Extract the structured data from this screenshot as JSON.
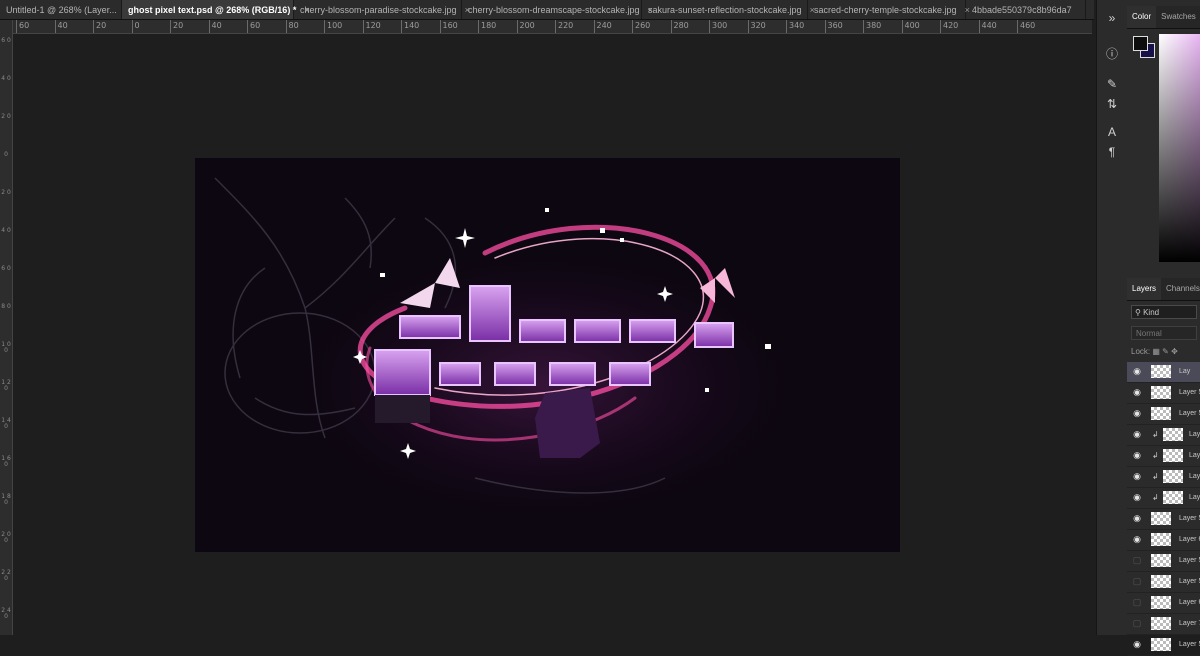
{
  "tabs": [
    {
      "label": "Untitled-1 @ 268% (Layer...",
      "active": false
    },
    {
      "label": "ghost pixel text.psd @ 268% (RGB/16) *",
      "active": true
    },
    {
      "label": "cherry-blossom-paradise-stockcake.jpg",
      "active": false
    },
    {
      "label": "cherry-blossom-dreamscape-stockcake.jpg",
      "active": false
    },
    {
      "label": "sakura-sunset-reflection-stockcake.jpg",
      "active": false
    },
    {
      "label": "sacred-cherry-temple-stockcake.jpg",
      "active": false
    },
    {
      "label": "4bbade550379c8b96da7",
      "active": false
    }
  ],
  "tab_close": "×",
  "overflow": "»",
  "ruler_top": [
    "60",
    "40",
    "20",
    "0",
    "20",
    "40",
    "60",
    "80",
    "100",
    "120",
    "140",
    "160",
    "180",
    "200",
    "220",
    "240",
    "260",
    "280",
    "300",
    "320",
    "340",
    "360",
    "380",
    "400",
    "420",
    "440",
    "460"
  ],
  "ruler_left": [
    "6 0",
    "4 0",
    "2 0",
    "0",
    "2 0",
    "4 0",
    "6 0",
    "8 0",
    "1 0 0",
    "1 2 0",
    "1 4 0",
    "1 6 0",
    "1 8 0",
    "2 0 0",
    "2 2 0",
    "2 4 0"
  ],
  "color_panel": {
    "tabs": [
      "Color",
      "Swatches"
    ],
    "fg": "#0d0d0d",
    "bg": "#17114a"
  },
  "layers_panel": {
    "tabs": [
      "Layers",
      "Channels"
    ],
    "kind_label": "Kind",
    "blend_mode": "Normal",
    "locks_label": "Lock:",
    "rows": [
      {
        "name": "Lay",
        "visible": true,
        "clipped": false,
        "selected": true
      },
      {
        "name": "Layer 5",
        "visible": true,
        "clipped": false,
        "selected": false
      },
      {
        "name": "Layer 5",
        "visible": true,
        "clipped": false,
        "selected": false
      },
      {
        "name": "Lay",
        "visible": true,
        "clipped": true,
        "selected": false
      },
      {
        "name": "Lay",
        "visible": true,
        "clipped": true,
        "selected": false
      },
      {
        "name": "Lay",
        "visible": true,
        "clipped": true,
        "selected": false
      },
      {
        "name": "Lay",
        "visible": true,
        "clipped": true,
        "selected": false
      },
      {
        "name": "Layer 5",
        "visible": true,
        "clipped": false,
        "selected": false
      },
      {
        "name": "Layer 6",
        "visible": true,
        "clipped": false,
        "selected": false
      },
      {
        "name": "Layer 5",
        "visible": false,
        "clipped": false,
        "selected": false
      },
      {
        "name": "Layer 5",
        "visible": false,
        "clipped": false,
        "selected": false
      },
      {
        "name": "Layer 6",
        "visible": false,
        "clipped": false,
        "selected": false
      },
      {
        "name": "Layer 7",
        "visible": false,
        "clipped": false,
        "selected": false
      },
      {
        "name": "Layer 5",
        "visible": true,
        "clipped": false,
        "selected": false
      }
    ]
  }
}
